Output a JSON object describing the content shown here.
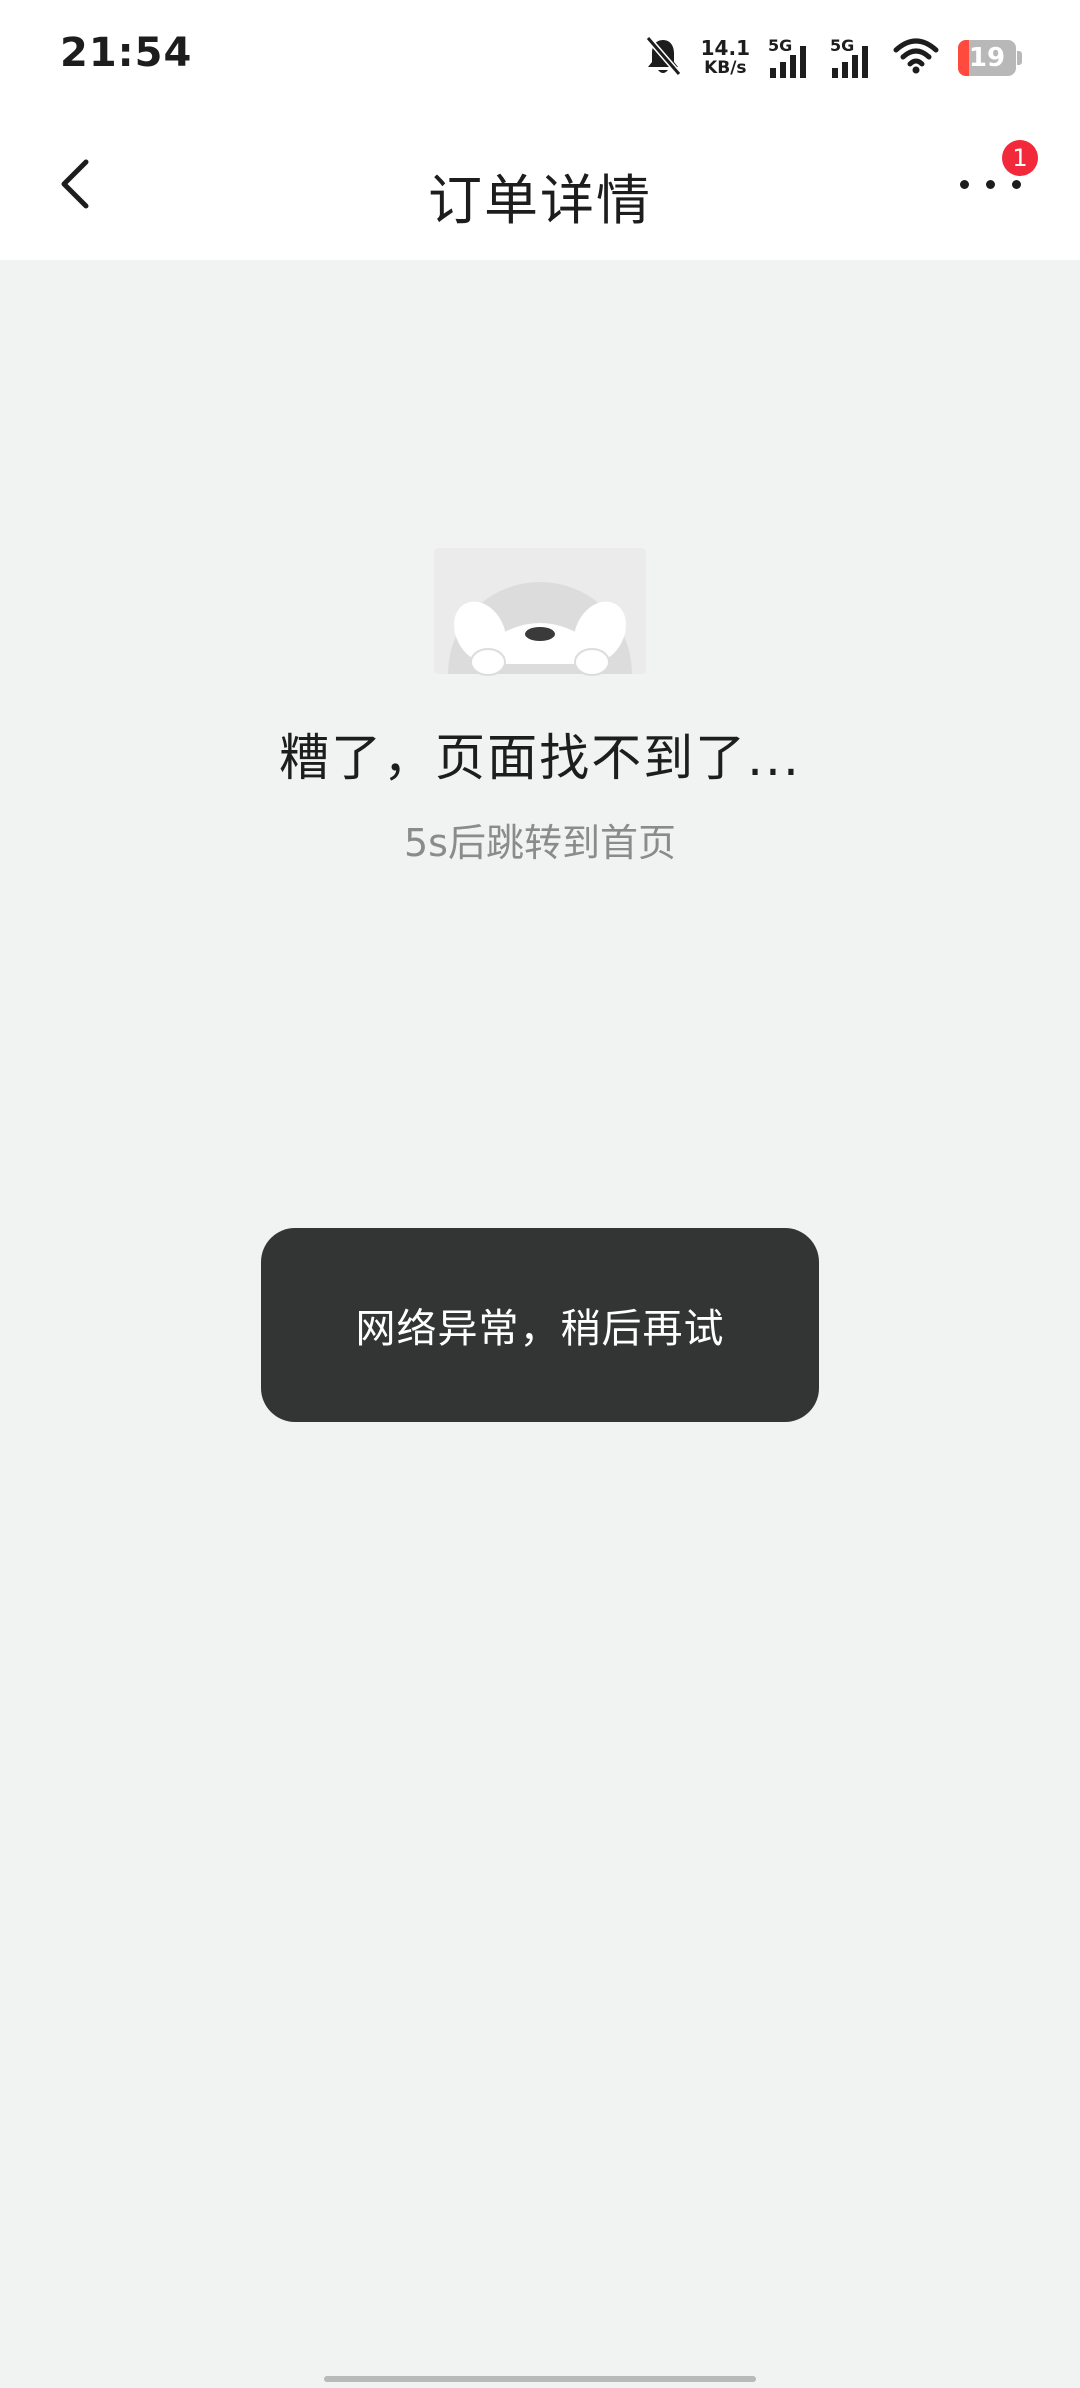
{
  "status_bar": {
    "time": "21:54",
    "net_speed_value": "14.1",
    "net_speed_unit": "KB/s",
    "sim1_label": "5G",
    "sim2_label": "5G",
    "battery_level": "19",
    "battery_color": "#ff4a3d",
    "icons": [
      "bell-muted-icon",
      "signal-icon",
      "wifi-icon",
      "battery-icon"
    ]
  },
  "header": {
    "title": "订单详情",
    "back_icon": "chevron-left-icon",
    "more_icon": "more-dots-icon",
    "more_badge": "1",
    "badge_color": "#f2293a"
  },
  "error_page": {
    "title": "糟了，页面找不到了...",
    "subtitle": "5s后跳转到首页"
  },
  "toast": {
    "message": "网络异常，稍后再试"
  }
}
